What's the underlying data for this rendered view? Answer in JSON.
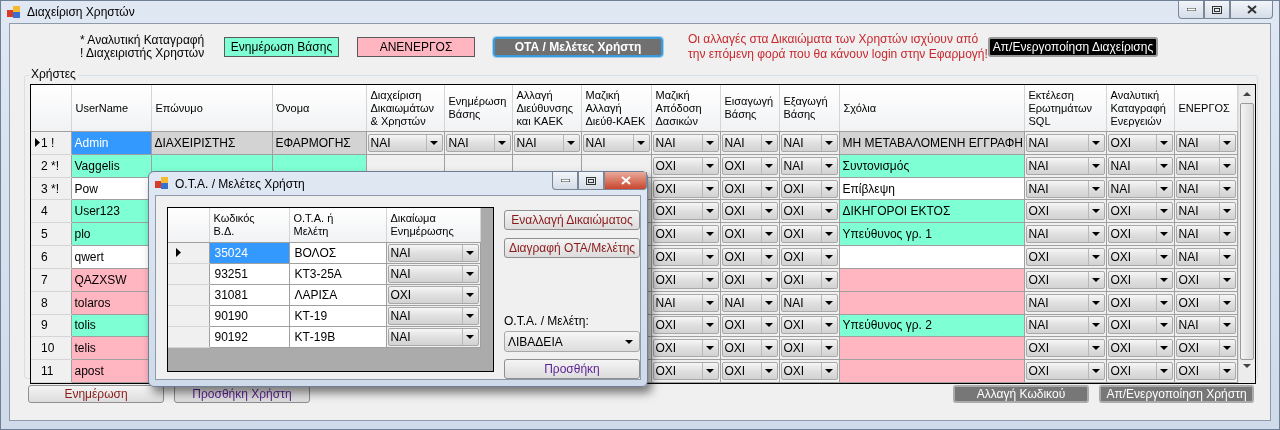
{
  "window": {
    "title": "Διαχείριση Χρηστών"
  },
  "legend": [
    "* Αναλυτική Καταγραφή",
    "! Διαχειριστής Χρηστών"
  ],
  "badges": [
    {
      "label": "Ενημέρωση Βάσης",
      "color": "#7fffd4"
    },
    {
      "label": "ΑΝΕΝΕΡΓΟΣ",
      "color": "#ffb6c1"
    }
  ],
  "top_buttons": [
    {
      "label": "ΟΤΑ / Μελέτες Χρήστη",
      "kind": "focused"
    },
    {
      "label": "Απ/Ενεργοποίηση Διαχείρισης",
      "kind": "dark"
    }
  ],
  "notice": "Οι αλλαγές στα Δικαιώματα των Χρηστών ισχύουν από την επόμενη φορά που θα κάνουν login στην Εφαρμογή!",
  "users": {
    "title": "Χρήστες",
    "columns": [
      {
        "label": "UserName",
        "kind": "text"
      },
      {
        "label": "Επώνυμο",
        "kind": "text"
      },
      {
        "label": "Όνομα",
        "kind": "text"
      },
      {
        "label": "Διαχείριση Δικαιωμάτων & Χρηστών",
        "kind": "dropdown"
      },
      {
        "label": "Ενημέρωση Βάσης",
        "kind": "dropdown"
      },
      {
        "label": "Αλλαγή Διεύθυνσης και ΚΑΕΚ",
        "kind": "dropdown"
      },
      {
        "label": "Μαζική Αλλαγή Διεύθ-ΚΑΕΚ",
        "kind": "dropdown"
      },
      {
        "label": "Μαζική Απόδοση Δασικών",
        "kind": "dropdown"
      },
      {
        "label": "Εισαγωγή Βάσης",
        "kind": "dropdown"
      },
      {
        "label": "Εξαγωγή Βάσης",
        "kind": "dropdown"
      },
      {
        "label": "Σχόλια",
        "kind": "text"
      },
      {
        "label": "Εκτέλεση Ερωτημάτων SQL",
        "kind": "dropdown"
      },
      {
        "label": "Αναλυτική Καταγραφή Ενεργειών",
        "kind": "dropdown"
      },
      {
        "label": "ΕΝΕΡΓΟΣ",
        "kind": "dropdown"
      }
    ],
    "rows": [
      {
        "header": "1 !",
        "current": true,
        "selected": true,
        "color": "#d3d3d3",
        "cells": [
          "Admin",
          "ΔΙΑΧΕΙΡΙΣΤΗΣ",
          "ΕΦΑΡΜΟΓΗΣ",
          "ΝΑΙ",
          "ΝΑΙ",
          "ΝΑΙ",
          "ΝΑΙ",
          "ΝΑΙ",
          "ΝΑΙ",
          "ΝΑΙ",
          "ΜΗ ΜΕΤΑΒΑΛΟΜΕΝΗ ΕΓΓΡΑΦΗ",
          "ΝΑΙ",
          "ΟΧΙ",
          "ΝΑΙ"
        ]
      },
      {
        "header": "2 *!",
        "current": false,
        "selected": false,
        "color": "#7fffd4",
        "cells": [
          "Vaggelis",
          null,
          null,
          null,
          null,
          null,
          null,
          "ΟΧΙ",
          "ΟΧΙ",
          "ΝΑΙ",
          "Συντονισμός",
          "ΝΑΙ",
          "ΝΑΙ",
          "ΝΑΙ"
        ]
      },
      {
        "header": "3 *!",
        "current": false,
        "selected": false,
        "color": "#ffffff",
        "cells": [
          "Pow",
          null,
          null,
          null,
          null,
          null,
          null,
          "ΟΧΙ",
          "ΟΧΙ",
          "ΟΧΙ",
          "Επίβλεψη",
          "ΝΑΙ",
          "ΝΑΙ",
          "ΝΑΙ"
        ]
      },
      {
        "header": "4",
        "current": false,
        "selected": false,
        "color": "#7fffd4",
        "cells": [
          "User123",
          null,
          null,
          null,
          null,
          null,
          null,
          "ΟΧΙ",
          "ΟΧΙ",
          "ΟΧΙ",
          "ΔΙΚΗΓΟΡΟΙ ΕΚΤΟΣ",
          "ΟΧΙ",
          "ΟΧΙ",
          "ΝΑΙ"
        ]
      },
      {
        "header": "5",
        "current": false,
        "selected": false,
        "color": "#7fffd4",
        "cells": [
          "plo",
          null,
          null,
          null,
          null,
          null,
          null,
          "ΟΧΙ",
          "ΟΧΙ",
          "ΟΧΙ",
          "Υπεύθυνος γρ. 1",
          "ΝΑΙ",
          "ΟΧΙ",
          "ΝΑΙ"
        ]
      },
      {
        "header": "6",
        "current": false,
        "selected": false,
        "color": "#ffffff",
        "cells": [
          "qwert",
          null,
          null,
          null,
          null,
          null,
          null,
          "ΟΧΙ",
          "ΟΧΙ",
          "ΟΧΙ",
          null,
          "ΟΧΙ",
          "ΟΧΙ",
          "ΝΑΙ"
        ]
      },
      {
        "header": "7",
        "current": false,
        "selected": false,
        "color": "#ffb6c1",
        "cells": [
          "QAZXSW",
          null,
          null,
          null,
          null,
          null,
          null,
          "ΟΧΙ",
          "ΟΧΙ",
          "ΟΧΙ",
          null,
          "ΟΧΙ",
          "ΟΧΙ",
          "ΟΧΙ"
        ]
      },
      {
        "header": "8",
        "current": false,
        "selected": false,
        "color": "#ffb6c1",
        "cells": [
          "tolaros",
          null,
          null,
          null,
          null,
          null,
          null,
          "ΝΑΙ",
          "ΝΑΙ",
          "ΝΑΙ",
          null,
          "ΝΑΙ",
          "ΟΧΙ",
          "ΟΧΙ"
        ]
      },
      {
        "header": "9",
        "current": false,
        "selected": false,
        "color": "#7fffd4",
        "cells": [
          "tolis",
          null,
          null,
          null,
          null,
          null,
          null,
          "ΟΧΙ",
          "ΟΧΙ",
          "ΟΧΙ",
          "Υπεύθυνος γρ. 2",
          "ΝΑΙ",
          "ΟΧΙ",
          "ΝΑΙ"
        ]
      },
      {
        "header": "10",
        "current": false,
        "selected": false,
        "color": "#ffb6c1",
        "cells": [
          "telis",
          null,
          null,
          null,
          null,
          null,
          null,
          "ΟΧΙ",
          "ΟΧΙ",
          "ΟΧΙ",
          null,
          "ΟΧΙ",
          "ΟΧΙ",
          "ΟΧΙ"
        ]
      },
      {
        "header": "11",
        "current": false,
        "selected": false,
        "color": "#ffb6c1",
        "cells": [
          "apost",
          null,
          null,
          null,
          null,
          null,
          null,
          "ΟΧΙ",
          "ΟΧΙ",
          "ΟΧΙ",
          null,
          "ΟΧΙ",
          "ΟΧΙ",
          "ΟΧΙ"
        ]
      }
    ]
  },
  "bottom_buttons": [
    {
      "label": "Ενημέρωση",
      "kind": "danger"
    },
    {
      "label": "Προσθήκη Χρήστη",
      "kind": "add"
    },
    {
      "label": "Αλλαγή Κωδικού",
      "kind": "gray"
    },
    {
      "label": "Απ/Ενεργοποίηση Χρήστη",
      "kind": "gray"
    }
  ],
  "dialog": {
    "title": "Ο.Τ.Α. / Μελέτες Χρήστη",
    "columns": [
      {
        "label": "Κωδικός Β.Δ.",
        "kind": "text"
      },
      {
        "label": "Ο.Τ.Α. ή Μελέτη",
        "kind": "text"
      },
      {
        "label": "Δικαίωμα Ενημέρωσης",
        "kind": "dropdown"
      }
    ],
    "rows": [
      {
        "current": true,
        "selected": true,
        "cells": [
          "35024",
          "ΒΟΛΟΣ",
          "ΝΑΙ"
        ]
      },
      {
        "current": false,
        "selected": false,
        "cells": [
          "93251",
          "ΚΤ3-25Α",
          "ΝΑΙ"
        ]
      },
      {
        "current": false,
        "selected": false,
        "cells": [
          "31081",
          "ΛΑΡΙΣΑ",
          "ΟΧΙ"
        ]
      },
      {
        "current": false,
        "selected": false,
        "cells": [
          "90190",
          "ΚΤ-19",
          "ΝΑΙ"
        ]
      },
      {
        "current": false,
        "selected": false,
        "cells": [
          "90192",
          "ΚΤ-19Β",
          "ΝΑΙ"
        ]
      }
    ],
    "buttons": [
      {
        "label": "Εναλλαγή Δικαιώματος",
        "kind": "danger"
      },
      {
        "label": "Διαγραφή ΟΤΑ/Μελέτης",
        "kind": "danger"
      }
    ],
    "picker": {
      "label": "Ο.Τ.Α. / Μελέτη:",
      "value": "ΛΙΒΑΔΕΙΑ"
    },
    "add_button": {
      "label": "Προσθήκη",
      "kind": "add"
    }
  }
}
